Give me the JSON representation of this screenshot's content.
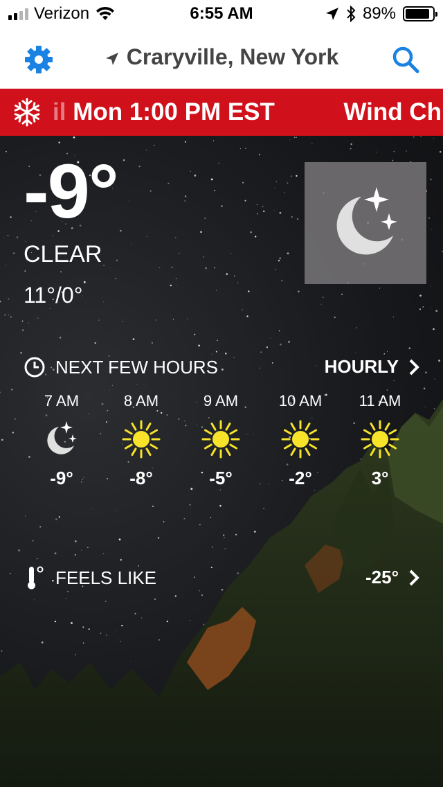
{
  "status_bar": {
    "carrier": "Verizon",
    "time": "6:55 AM",
    "battery": "89%",
    "battery_level": 0.89
  },
  "nav": {
    "location": "Craryville, New York",
    "icons": [
      "gear-icon",
      "location-arrow-icon",
      "search-icon"
    ]
  },
  "ticker": {
    "faded_text": "il",
    "text": "Mon 1:00 PM EST",
    "next_text": "Wind Chi",
    "icon": "snowflake-icon",
    "color": "#d0101a"
  },
  "current": {
    "temperature": "-9°",
    "condition": "CLEAR",
    "hi_lo": "11°/0°",
    "icon": "moon-stars-icon"
  },
  "next_hours": {
    "title": "NEXT FEW HOURS",
    "link": "HOURLY",
    "hours": [
      {
        "time": "7 AM",
        "icon": "moon-stars-icon",
        "temp": "-9°"
      },
      {
        "time": "8 AM",
        "icon": "sun-icon",
        "temp": "-8°"
      },
      {
        "time": "9 AM",
        "icon": "sun-icon",
        "temp": "-5°"
      },
      {
        "time": "10 AM",
        "icon": "sun-icon",
        "temp": "-2°"
      },
      {
        "time": "11 AM",
        "icon": "sun-icon",
        "temp": "3°"
      }
    ]
  },
  "feels_like": {
    "label": "FEELS LIKE",
    "value": "-25°"
  },
  "colors": {
    "accent_blue": "#1a82e2",
    "sun_yellow": "#f6e32a"
  }
}
